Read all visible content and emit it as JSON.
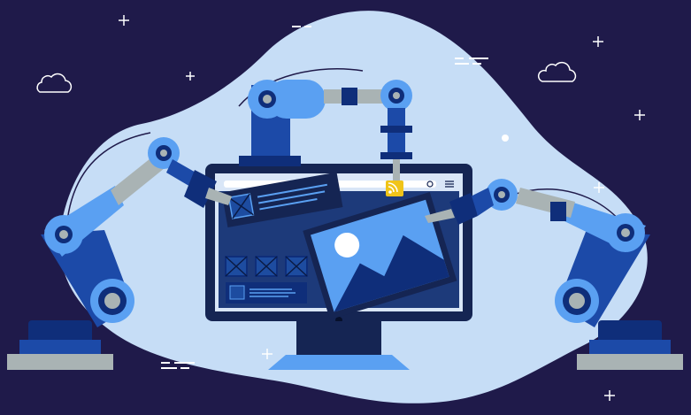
{
  "colors": {
    "background": "#1f1a4a",
    "blob": "#c6ddf6",
    "monitor_frame": "#152553",
    "screen": "#d9e6f7",
    "arm_light": "#5aa0f2",
    "arm_dark": "#1c4aa8",
    "arm_navy": "#0f2e7a",
    "steel": "#a9b3b4",
    "accent_yellow": "#f0c419",
    "white": "#ffffff"
  },
  "icons": [
    "robotic-arm-icon",
    "monitor-icon",
    "image-placeholder-icon",
    "rss-icon",
    "cloud-icon",
    "sparkle-icon",
    "hamburger-menu-icon",
    "refresh-icon"
  ],
  "illustration": {
    "theme": "web-development-automation"
  }
}
